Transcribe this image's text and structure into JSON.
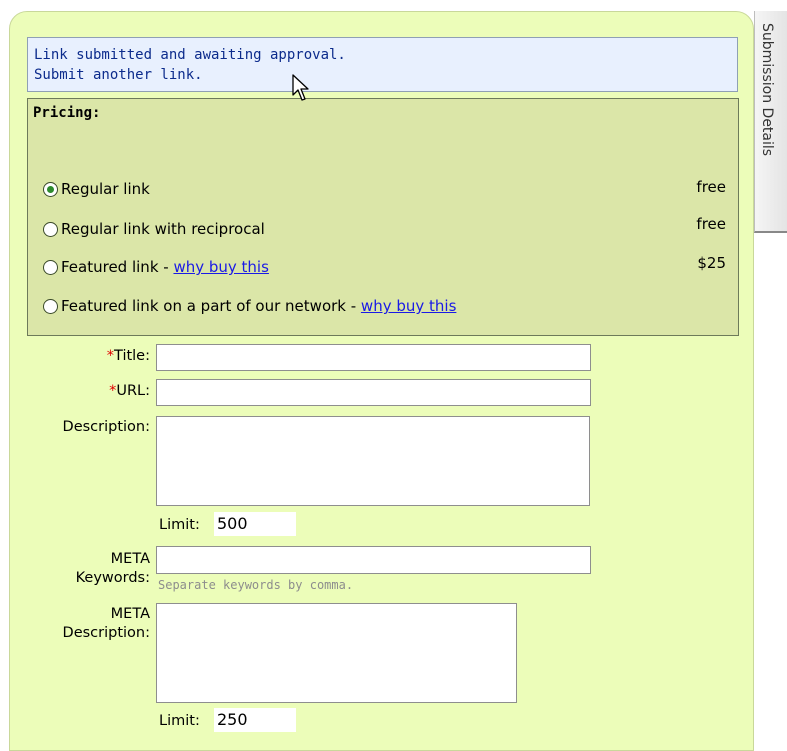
{
  "message": {
    "line1": "Link submitted and awaiting approval.",
    "line2": "Submit another link."
  },
  "side_tab": {
    "label": "Submission Details"
  },
  "pricing": {
    "heading": "Pricing:",
    "options": [
      {
        "label": "Regular link",
        "price": "free",
        "checked": true
      },
      {
        "label": "Regular link with reciprocal",
        "price": "free",
        "checked": false
      },
      {
        "label": "Featured link - ",
        "link": "why buy this",
        "price": "$25",
        "checked": false
      },
      {
        "label": "Featured link on a part of our network - ",
        "link": "why buy this",
        "price": "",
        "checked": false
      }
    ]
  },
  "form": {
    "title_label": "Title:",
    "url_label": "URL:",
    "required_mark": "*",
    "description_label": "Description:",
    "limit_label": "Limit:",
    "description_limit": "500",
    "meta_keywords_label_1": "META",
    "meta_keywords_label_2": "Keywords:",
    "meta_keywords_hint": "Separate keywords by comma.",
    "meta_description_label_1": "META",
    "meta_description_label_2": "Description:",
    "meta_description_limit": "250"
  }
}
